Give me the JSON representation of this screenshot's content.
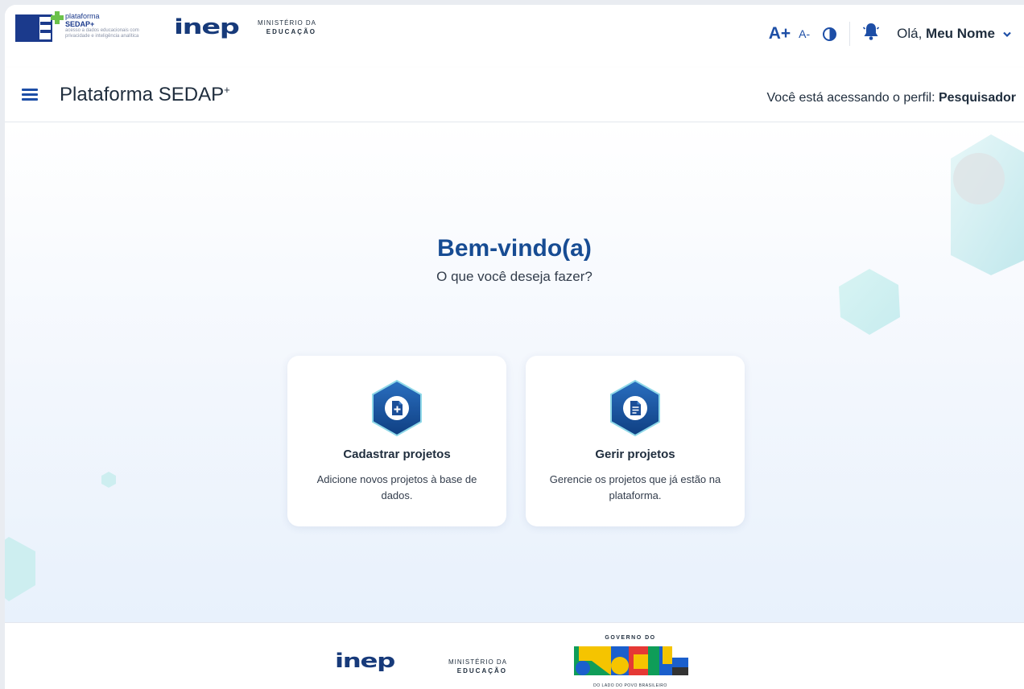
{
  "header": {
    "sedap_logo": {
      "line1": "plataforma",
      "line2": "SEDAP+",
      "line3": "acesso a dados educacionais com privacidade e inteligência analítica"
    },
    "inep_logo": "inep",
    "mec_logo": {
      "line1": "MINISTÉRIO DA",
      "line2": "EDUCAÇÃO"
    },
    "font_increase": "A+",
    "font_decrease": "A-",
    "contrast_icon": "contrast-icon",
    "bell_icon": "bell-icon",
    "greeting_prefix": "Olá, ",
    "user_name": "Meu Nome"
  },
  "navbar": {
    "title": "Plataforma SEDAP",
    "title_sup": "+",
    "profile_prefix": "Você está acessando o perfil: ",
    "profile_name": "Pesquisador"
  },
  "main": {
    "title": "Bem-vindo(a)",
    "subtitle": "O que você deseja fazer?",
    "cards": [
      {
        "title": "Cadastrar projetos",
        "description": "Adicione novos projetos à base de dados.",
        "icon": "add-document-icon"
      },
      {
        "title": "Gerir projetos",
        "description": "Gerencie os projetos que já estão na plataforma.",
        "icon": "document-icon"
      }
    ]
  },
  "footer": {
    "inep_logo": "inep",
    "mec_logo": {
      "line1": "MINISTÉRIO DA",
      "line2": "EDUCAÇÃO"
    },
    "gov_logo": {
      "line1": "GOVERNO DO",
      "line2": "BRASIL",
      "line3": "DO LADO DO POVO BRASILEIRO"
    }
  },
  "colors": {
    "primary": "#1d4ea6",
    "title": "#174c93",
    "icon_gradient_top": "#2a6fc0",
    "icon_gradient_bottom": "#0f3f82",
    "hex_teal": "#bfeaf0"
  }
}
